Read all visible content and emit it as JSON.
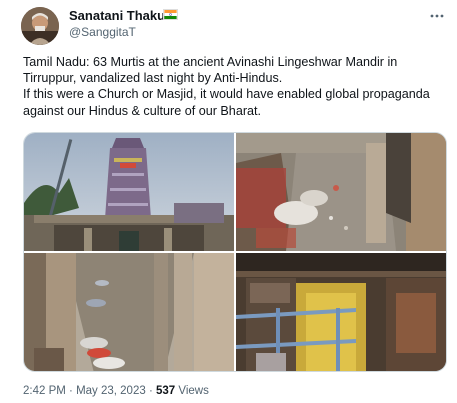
{
  "author": {
    "name": "Sanatani Thakur",
    "handle": "@SanggitaT"
  },
  "icons": {
    "flag": "india-flag-icon",
    "more": "more-options-icon"
  },
  "tweet": {
    "text": "Tamil Nadu: 63 Murtis at the ancient Avinashi Lingeshwar Mandir in Tirruppur, vandalized last night by Anti-Hindus.\nIf this were a Church or Masjid, it would have enabled global propaganda against our Hindus & culture of our Bharat."
  },
  "media": {
    "images": [
      {
        "subject": "temple-gopuram"
      },
      {
        "subject": "damaged-murtis-corridor"
      },
      {
        "subject": "wrapped-murtis-among-pillars"
      },
      {
        "subject": "temple-interior-scaffolding"
      }
    ]
  },
  "meta": {
    "time": "2:42 PM",
    "separator_1": " · ",
    "date": "May 23, 2023",
    "separator_2": " · ",
    "views_count": "537",
    "views_label": " Views"
  },
  "colors": {
    "primary_text": "#0f1419",
    "secondary_text": "#536471",
    "border": "#cfd9de"
  }
}
